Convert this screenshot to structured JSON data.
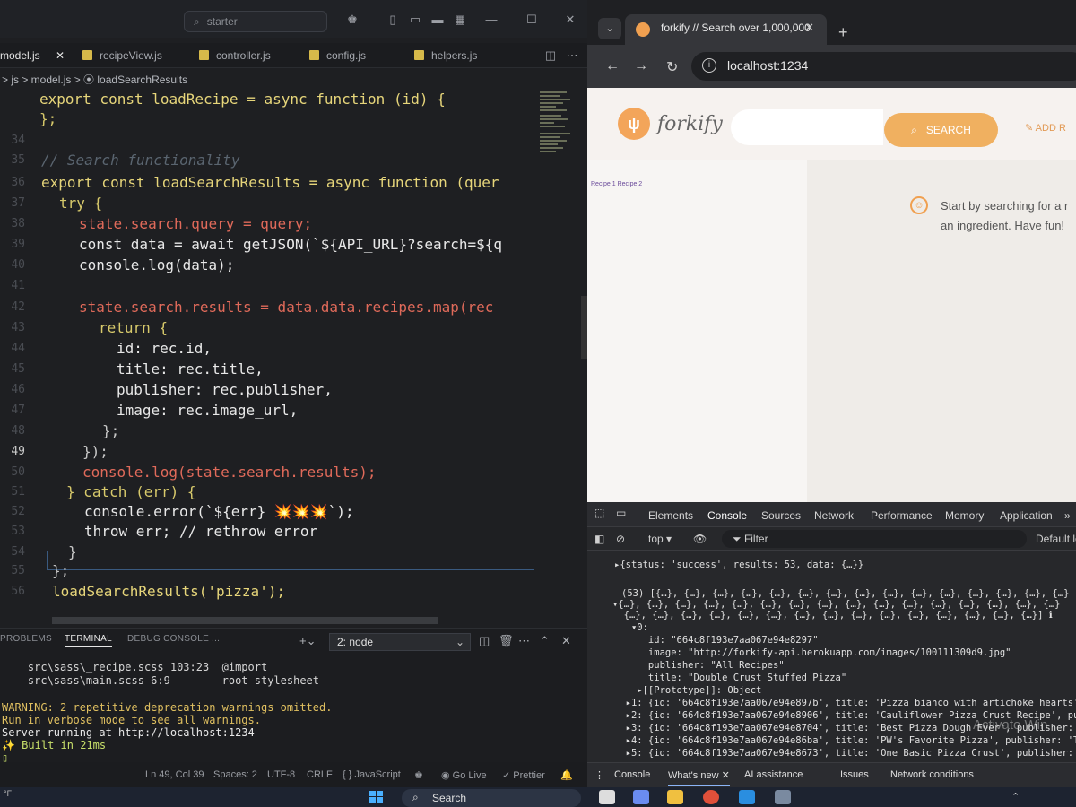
{
  "vscode": {
    "title_search": "starter",
    "tabs": [
      {
        "label": "model.js",
        "active": true,
        "close": "✕"
      },
      {
        "label": "recipeView.js"
      },
      {
        "label": "controller.js"
      },
      {
        "label": "config.js"
      },
      {
        "label": "helpers.js"
      }
    ],
    "breadcrumb": "> js > model.js > ⦿ loadSearchResults",
    "line_numbers": [
      "",
      "",
      "",
      "34",
      "35",
      "36",
      "37",
      "38",
      "39",
      "40",
      "41",
      "42",
      "43",
      "44",
      "45",
      "46",
      "47",
      "48",
      "49",
      "50",
      "51",
      "52",
      "53",
      "54",
      "55",
      "56"
    ],
    "current_line": "49",
    "code": [
      "export const loadRecipe = async function (id) {",
      "};",
      "",
      "// Search functionality",
      "export const loadSearchResults = async function (quer",
      "try {",
      "state.search.query = query;",
      "const data = await getJSON(`${API_URL}?search=${q",
      "console.log(data);",
      "",
      "state.search.results = data.data.recipes.map(rec",
      "return {",
      "id: rec.id,",
      "title: rec.title,",
      "publisher: rec.publisher,",
      "image: rec.image_url,",
      "};",
      "});",
      "console.log(state.search.results);",
      "} catch (err) {",
      "console.error(`${err} 💥💥💥`);",
      "throw err; // rethrow error",
      "}",
      "};",
      "loadSearchResults('pizza');"
    ],
    "panel": {
      "tabs": [
        "PROBLEMS",
        "TERMINAL",
        "DEBUG CONSOLE",
        "..."
      ],
      "active_tab": "TERMINAL",
      "terminal_select": "2: node",
      "lines": [
        "    src\\sass\\_recipe.scss 103:23  @import",
        "    src\\sass\\main.scss 6:9        root stylesheet",
        "",
        "WARNING: 2 repetitive deprecation warnings omitted.",
        "Run in verbose mode to see all warnings.",
        "Server running at http://localhost:1234",
        "✨ Built in 21ms",
        "▯"
      ]
    },
    "status": {
      "position": "Ln 49, Col 39",
      "spaces": "Spaces: 2",
      "encoding": "UTF-8",
      "eol": "CRLF",
      "language": "{ } JavaScript",
      "golive": "Go Live",
      "prettier": "✓ Prettier"
    }
  },
  "chrome": {
    "tab_title": "forkify // Search over 1,000,000",
    "tab_close": "✕",
    "new_tab": "+",
    "url": "localhost:1234",
    "page": {
      "brand": "forkify",
      "search_button": "SEARCH",
      "add_recipe": "ADD R",
      "pagination": "Recipe 1 Recipe 2",
      "message_line1": "Start by searching for a r",
      "message_line2": "an ingredient. Have fun!"
    },
    "devtools": {
      "tabs": [
        "Elements",
        "Console",
        "Sources",
        "Network",
        "Performance",
        "Memory",
        "Application",
        "»"
      ],
      "active_tab": "Console",
      "context": "top ▾",
      "filter_placeholder": "Filter",
      "default_levels": "Default le",
      "console_lines": {
        "l1": "▸{status: 'success', results: 53, data: {…}}",
        "l2": "(53) [{…}, {…}, {…}, {…}, {…}, {…}, {…}, {…}, {…}, {…}, {…}, {…}, {…}, {…}, {…}",
        "l3": "▾{…}, {…}, {…}, {…}, {…}, {…}, {…}, {…}, {…}, {…}, {…}, {…}, {…}, {…}, {…}, {…}",
        "l4": "  {…}, {…}, {…}, {…}, {…}, {…}, {…}, {…}, {…}, {…}, {…}, {…}, {…}, {…}, {…}] ℹ",
        "l5": "   ▾0:",
        "l6": "      id: \"664c8f193e7aa067e94e8297\"",
        "l7": "      image: \"http://forkify-api.herokuapp.com/images/100111309d9.jpg\"",
        "l8": "      publisher: \"All Recipes\"",
        "l9": "      title: \"Double Crust Stuffed Pizza\"",
        "l10": "    ▸[[Prototype]]: Object",
        "l11": "  ▸1: {id: '664c8f193e7aa067e94e897b', title: 'Pizza bianco with artichoke hearts', p",
        "l12": "  ▸2: {id: '664c8f193e7aa067e94e8906', title: 'Cauliflower Pizza Crust Recipe', publ",
        "l13": "  ▸3: {id: '664c8f193e7aa067e94e8704', title: 'Best Pizza Dough Ever', publisher: '101",
        "l14": "  ▸4: {id: '664c8f193e7aa067e94e86ba', title: 'PW's Favorite Pizza', publisher: 'The P",
        "l15": "  ▸5: {id: '664c8f193e7aa067e94e8673', title: 'One Basic Pizza Crust', publisher: 'The"
      },
      "drawer_tabs": [
        "Console",
        "What's new ✕",
        "AI assistance",
        "Issues",
        "Network conditions"
      ],
      "drawer_active": "What's new ✕"
    }
  },
  "taskbar": {
    "search": "Search",
    "left_text": "°F"
  },
  "watermark": "Activate Win"
}
